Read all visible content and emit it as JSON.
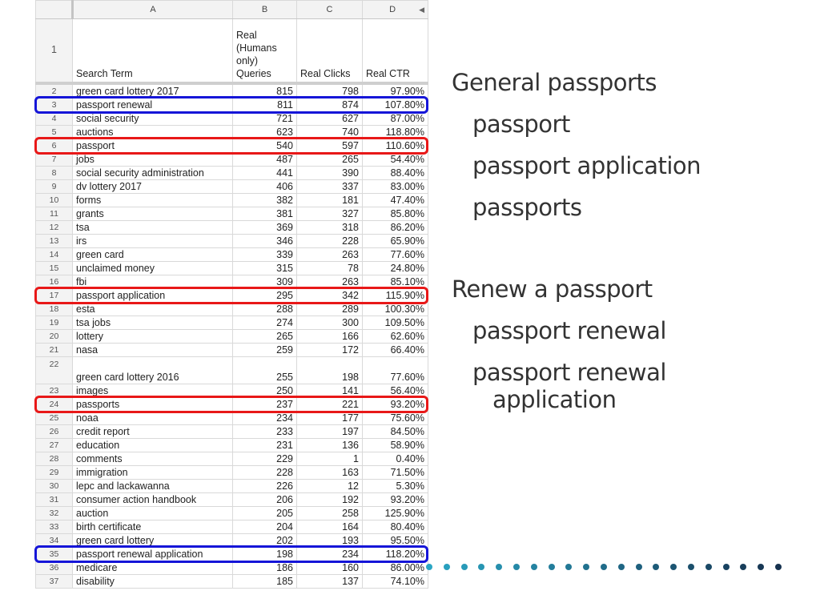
{
  "spreadsheet": {
    "column_letters": [
      "A",
      "B",
      "C",
      "D"
    ],
    "header_row_number": "1",
    "headers": {
      "search_term": "Search Term",
      "queries_line1": "Real",
      "queries_line2": "(Humans",
      "queries_line3": "only)",
      "queries_line4": "Queries",
      "clicks": "Real Clicks",
      "ctr": "Real CTR"
    },
    "rows": [
      {
        "n": "2",
        "term": "green card lottery 2017",
        "queries": "815",
        "clicks": "798",
        "ctr": "97.90%"
      },
      {
        "n": "3",
        "term": "passport renewal",
        "queries": "811",
        "clicks": "874",
        "ctr": "107.80%",
        "highlight": "blue"
      },
      {
        "n": "4",
        "term": "social security",
        "queries": "721",
        "clicks": "627",
        "ctr": "87.00%"
      },
      {
        "n": "5",
        "term": "auctions",
        "queries": "623",
        "clicks": "740",
        "ctr": "118.80%"
      },
      {
        "n": "6",
        "term": "passport",
        "queries": "540",
        "clicks": "597",
        "ctr": "110.60%",
        "highlight": "red"
      },
      {
        "n": "7",
        "term": "jobs",
        "queries": "487",
        "clicks": "265",
        "ctr": "54.40%"
      },
      {
        "n": "8",
        "term": "social security administration",
        "queries": "441",
        "clicks": "390",
        "ctr": "88.40%"
      },
      {
        "n": "9",
        "term": "dv lottery 2017",
        "queries": "406",
        "clicks": "337",
        "ctr": "83.00%"
      },
      {
        "n": "10",
        "term": "forms",
        "queries": "382",
        "clicks": "181",
        "ctr": "47.40%"
      },
      {
        "n": "11",
        "term": "grants",
        "queries": "381",
        "clicks": "327",
        "ctr": "85.80%"
      },
      {
        "n": "12",
        "term": "tsa",
        "queries": "369",
        "clicks": "318",
        "ctr": "86.20%"
      },
      {
        "n": "13",
        "term": "irs",
        "queries": "346",
        "clicks": "228",
        "ctr": "65.90%"
      },
      {
        "n": "14",
        "term": "green card",
        "queries": "339",
        "clicks": "263",
        "ctr": "77.60%"
      },
      {
        "n": "15",
        "term": "unclaimed money",
        "queries": "315",
        "clicks": "78",
        "ctr": "24.80%"
      },
      {
        "n": "16",
        "term": "fbi",
        "queries": "309",
        "clicks": "263",
        "ctr": "85.10%"
      },
      {
        "n": "17",
        "term": "passport application",
        "queries": "295",
        "clicks": "342",
        "ctr": "115.90%",
        "highlight": "red"
      },
      {
        "n": "18",
        "term": "esta",
        "queries": "288",
        "clicks": "289",
        "ctr": "100.30%"
      },
      {
        "n": "19",
        "term": "tsa jobs",
        "queries": "274",
        "clicks": "300",
        "ctr": "109.50%"
      },
      {
        "n": "20",
        "term": "lottery",
        "queries": "265",
        "clicks": "166",
        "ctr": "62.60%"
      },
      {
        "n": "21",
        "term": "nasa",
        "queries": "259",
        "clicks": "172",
        "ctr": "66.40%"
      },
      {
        "n": "22",
        "term": "green card lottery 2016",
        "queries": "255",
        "clicks": "198",
        "ctr": "77.60%"
      },
      {
        "n": "23",
        "term": "images",
        "queries": "250",
        "clicks": "141",
        "ctr": "56.40%"
      },
      {
        "n": "24",
        "term": "passports",
        "queries": "237",
        "clicks": "221",
        "ctr": "93.20%",
        "highlight": "red"
      },
      {
        "n": "25",
        "term": "noaa",
        "queries": "234",
        "clicks": "177",
        "ctr": "75.60%"
      },
      {
        "n": "26",
        "term": "credit report",
        "queries": "233",
        "clicks": "197",
        "ctr": "84.50%"
      },
      {
        "n": "27",
        "term": "education",
        "queries": "231",
        "clicks": "136",
        "ctr": "58.90%"
      },
      {
        "n": "28",
        "term": "comments",
        "queries": "229",
        "clicks": "1",
        "ctr": "0.40%"
      },
      {
        "n": "29",
        "term": "immigration",
        "queries": "228",
        "clicks": "163",
        "ctr": "71.50%"
      },
      {
        "n": "30",
        "term": "lepc and lackawanna",
        "queries": "226",
        "clicks": "12",
        "ctr": "5.30%"
      },
      {
        "n": "31",
        "term": "consumer action handbook",
        "queries": "206",
        "clicks": "192",
        "ctr": "93.20%"
      },
      {
        "n": "32",
        "term": "auction",
        "queries": "205",
        "clicks": "258",
        "ctr": "125.90%"
      },
      {
        "n": "33",
        "term": "birth certificate",
        "queries": "204",
        "clicks": "164",
        "ctr": "80.40%"
      },
      {
        "n": "34",
        "term": "green card lottery",
        "queries": "202",
        "clicks": "193",
        "ctr": "95.50%"
      },
      {
        "n": "35",
        "term": "passport renewal application",
        "queries": "198",
        "clicks": "234",
        "ctr": "118.20%",
        "highlight": "blue"
      },
      {
        "n": "36",
        "term": "medicare",
        "queries": "186",
        "clicks": "160",
        "ctr": "86.00%"
      },
      {
        "n": "37",
        "term": "disability",
        "queries": "185",
        "clicks": "137",
        "ctr": "74.10%"
      }
    ],
    "highlight_colors": {
      "blue": "#1515d8",
      "red": "#e81818"
    }
  },
  "notes": {
    "groups": [
      {
        "title": "General passports",
        "items": [
          "passport",
          "passport application",
          "passports"
        ]
      },
      {
        "title": "Renew a passport",
        "items": [
          "passport renewal",
          "passport renewal application"
        ]
      }
    ],
    "text_color": "#333333"
  },
  "decoration": {
    "dot_count": 21,
    "dot_color_start": "#2aa6c4",
    "dot_color_end": "#16324f"
  }
}
